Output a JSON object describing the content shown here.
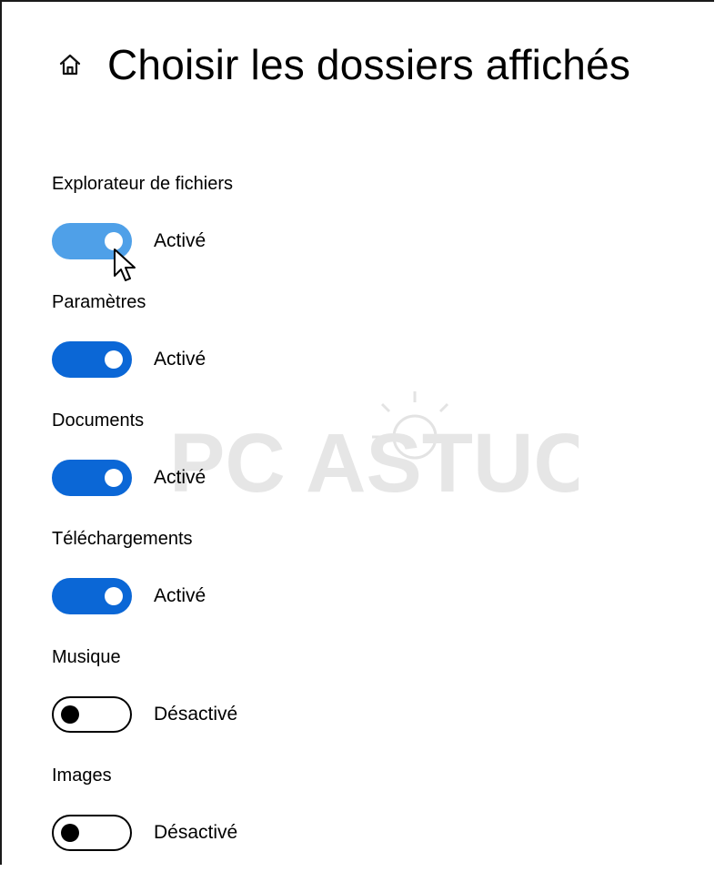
{
  "header": {
    "home_icon": "home-icon",
    "title": "Choisir les dossiers affichés"
  },
  "settings": [
    {
      "label": "Explorateur de fichiers",
      "state": "on",
      "state_text": "Activé",
      "hovered": true
    },
    {
      "label": "Paramètres",
      "state": "on",
      "state_text": "Activé"
    },
    {
      "label": "Documents",
      "state": "on",
      "state_text": "Activé"
    },
    {
      "label": "Téléchargements",
      "state": "on",
      "state_text": "Activé"
    },
    {
      "label": "Musique",
      "state": "off",
      "state_text": "Désactivé"
    },
    {
      "label": "Images",
      "state": "off",
      "state_text": "Désactivé"
    }
  ],
  "watermark": {
    "text": "PC ASTUCES"
  },
  "colors": {
    "toggle_on": "#0b67d6",
    "toggle_on_hover": "#4fa0e8",
    "toggle_off_border": "#000000",
    "background": "#ffffff"
  }
}
